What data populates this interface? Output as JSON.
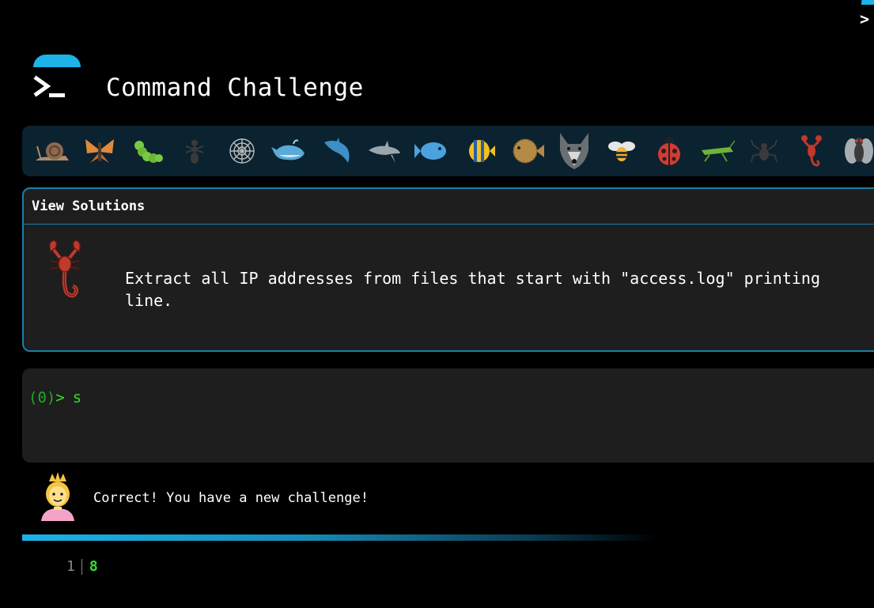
{
  "app": {
    "title": "Command Challenge"
  },
  "animals": [
    "snail-icon",
    "butterfly-icon",
    "caterpillar-icon",
    "ant-icon",
    "spider-web-icon",
    "whale-icon",
    "dolphin-icon",
    "dolphin-icon",
    "fish-icon",
    "tropical-fish-icon",
    "blowfish-icon",
    "wolf-icon",
    "bee-icon",
    "ladybug-icon",
    "cricket-icon",
    "spider-icon",
    "scorpion-icon",
    "fly-icon"
  ],
  "challenge": {
    "view_solutions_label": "View Solutions",
    "icon": "scorpion-icon",
    "description": "Extract all IP addresses from files that start with \"access.log\" printing\nline."
  },
  "terminal": {
    "exit_code": "(0)",
    "prompt_symbol": ">",
    "command": "s"
  },
  "feedback": {
    "avatar": "princess-icon",
    "message": "Correct! You have a new challenge!"
  },
  "progress": {
    "level": "1",
    "count": "8"
  },
  "colors": {
    "accent": "#1bb3e8",
    "prompt": "#33dd33",
    "panel": "#1e1e1e",
    "bar": "#0b2230"
  }
}
